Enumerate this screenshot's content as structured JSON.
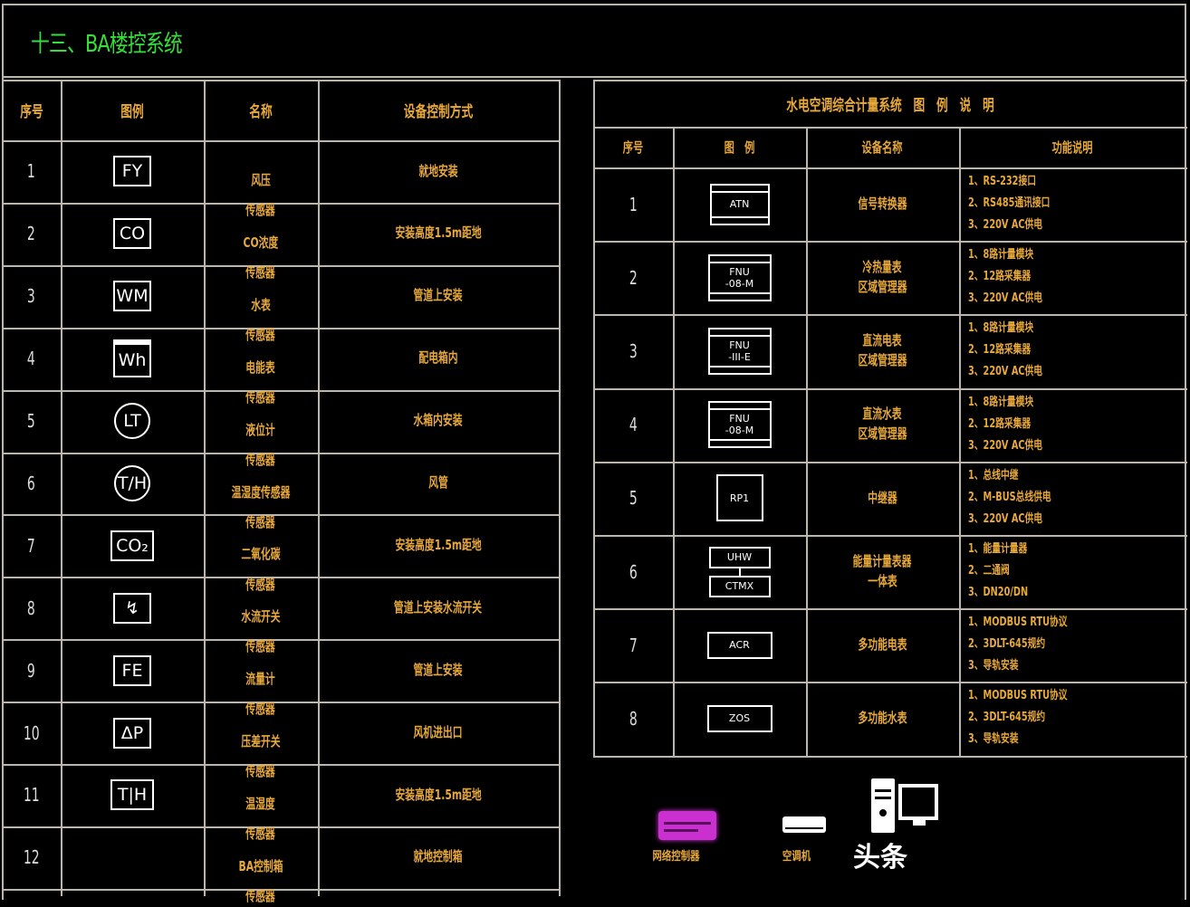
{
  "title": "十三、BA楼控系统",
  "left_table": {
    "headers": [
      "序号",
      "图例",
      "名称",
      "设备控制方式"
    ],
    "rows": [
      {
        "no": "1",
        "symbol": "FY",
        "shape": "box",
        "name": [
          "风压",
          "传感器"
        ],
        "control": "就地安装"
      },
      {
        "no": "2",
        "symbol": "CO",
        "shape": "box",
        "name": [
          "CO浓度",
          "传感器"
        ],
        "control": "安装高度1.5m距地"
      },
      {
        "no": "3",
        "symbol": "WM",
        "shape": "box",
        "name": [
          "水表",
          "传感器"
        ],
        "control": "管道上安装"
      },
      {
        "no": "4",
        "symbol": "Wh",
        "shape": "box-top",
        "name": [
          "电能表",
          "传感器"
        ],
        "control": "配电箱内"
      },
      {
        "no": "5",
        "symbol": "LT",
        "shape": "circle",
        "name": [
          "液位计",
          "传感器"
        ],
        "control": "水箱内安装"
      },
      {
        "no": "6",
        "symbol": "T/H",
        "shape": "circle",
        "name": [
          "温湿度传感器",
          "传感器"
        ],
        "control": "风管"
      },
      {
        "no": "7",
        "symbol": "CO₂",
        "shape": "box",
        "name": [
          "二氧化碳",
          "传感器"
        ],
        "control": "安装高度1.5m距地"
      },
      {
        "no": "8",
        "symbol": "↯",
        "shape": "box",
        "name": [
          "水流开关",
          "传感器"
        ],
        "control": "管道上安装水流开关"
      },
      {
        "no": "9",
        "symbol": "FE",
        "shape": "box",
        "name": [
          "流量计",
          "传感器"
        ],
        "control": "管道上安装"
      },
      {
        "no": "10",
        "symbol": "ΔP",
        "shape": "box",
        "name": [
          "压差开关",
          "传感器"
        ],
        "control": "风机进出口"
      },
      {
        "no": "11",
        "symbol": "T|H",
        "shape": "box",
        "name": [
          "温湿度",
          "传感器"
        ],
        "control": "安装高度1.5m距地"
      },
      {
        "no": "12",
        "symbol": "",
        "shape": "none",
        "name": [
          "BA控制箱",
          "传感器"
        ],
        "control": "就地控制箱"
      }
    ]
  },
  "right_table": {
    "title": "水电空调综合计量系统　图　例　说　明",
    "headers": [
      "序号",
      "图　例",
      "设备名称",
      "功能说明"
    ],
    "rows": [
      {
        "no": "1",
        "symbol": [
          "ATN"
        ],
        "name": [
          "信号转换器"
        ],
        "func": [
          "1、RS-232接口",
          "2、RS485通讯接口",
          "3、220V AC供电"
        ]
      },
      {
        "no": "2",
        "symbol": [
          "FNU",
          "-08-M"
        ],
        "name": [
          "冷热量表",
          "区域管理器"
        ],
        "func": [
          "1、8路计量模块",
          "2、12路采集器",
          "3、220V AC供电"
        ]
      },
      {
        "no": "3",
        "symbol": [
          "FNU",
          "-III-E"
        ],
        "name": [
          "直流电表",
          "区域管理器"
        ],
        "func": [
          "1、8路计量模块",
          "2、12路采集器",
          "3、220V AC供电"
        ]
      },
      {
        "no": "4",
        "symbol": [
          "FNU",
          "-08-M"
        ],
        "name": [
          "直流水表",
          "区域管理器"
        ],
        "func": [
          "1、8路计量模块",
          "2、12路采集器",
          "3、220V AC供电"
        ]
      },
      {
        "no": "5",
        "symbol": [
          "RP1"
        ],
        "name": [
          "中继器"
        ],
        "func": [
          "1、总线中继",
          "2、M-BUS总线供电",
          "3、220V AC供电"
        ]
      },
      {
        "no": "6",
        "symbol": [
          "UHW",
          "CTMX"
        ],
        "name": [
          "能量计量表器",
          "一体表"
        ],
        "func": [
          "1、能量计量器",
          "2、二通阀",
          "3、DN20/DN"
        ]
      },
      {
        "no": "7",
        "symbol": [
          "ACR"
        ],
        "name": [
          "多功能电表"
        ],
        "func": [
          "1、MODBUS RTU协议",
          "2、3DLT-645规约",
          "3、导轨安装"
        ]
      },
      {
        "no": "8",
        "symbol": [
          "ZOS"
        ],
        "name": [
          "多功能水表"
        ],
        "func": [
          "1、MODBUS RTU协议",
          "2、3DLT-645规约",
          "3、导轨安装"
        ]
      }
    ]
  },
  "legend_icons": [
    {
      "icon": "network-controller-icon",
      "label": "网络控制器",
      "color": "#d43ad8"
    },
    {
      "icon": "air-conditioner-icon",
      "label": "空调机",
      "color": "#ffffff"
    },
    {
      "icon": "computer-icon",
      "label": "",
      "color": "#ffffff"
    }
  ],
  "watermark": "头条",
  "colors": {
    "background": "#000000",
    "grid": "#bdb6ad",
    "text": "#e8a93a",
    "title": "#35e03a",
    "symbol": "#ffffff"
  }
}
